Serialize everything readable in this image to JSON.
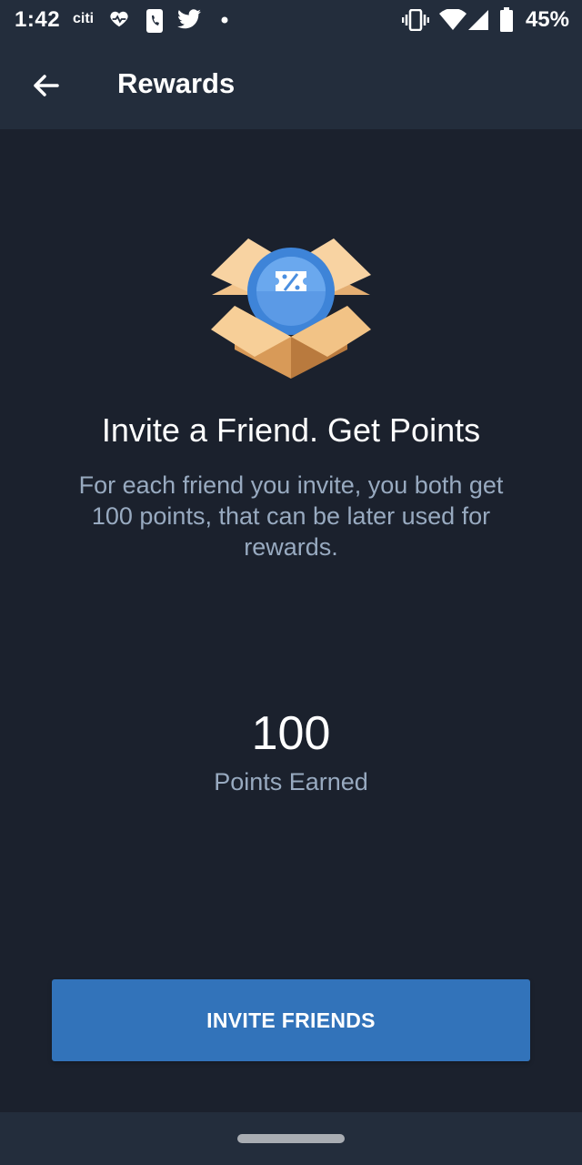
{
  "status_bar": {
    "time": "1:42",
    "carrier_label": "citi",
    "battery_percent": "45%",
    "icons": [
      "citi-icon",
      "heart-rate-icon",
      "phone-icon",
      "twitter-icon",
      "dot-icon",
      "vibrate-icon",
      "wifi-icon",
      "signal-icon",
      "battery-icon"
    ]
  },
  "app_bar": {
    "title": "Rewards",
    "back_icon": "arrow-left-icon"
  },
  "promo": {
    "illustration_icon": "gift-box-coupon-icon",
    "headline": "Invite a Friend. Get Points",
    "description": "For each friend you invite, you both get 100 points, that can be later used for rewards."
  },
  "points": {
    "value": "100",
    "label": "Points Earned"
  },
  "actions": {
    "invite_label": "INVITE FRIENDS"
  },
  "colors": {
    "background": "#1b212d",
    "app_bar": "#232d3c",
    "primary_button": "#3273ba",
    "secondary_text": "#98aac0"
  }
}
